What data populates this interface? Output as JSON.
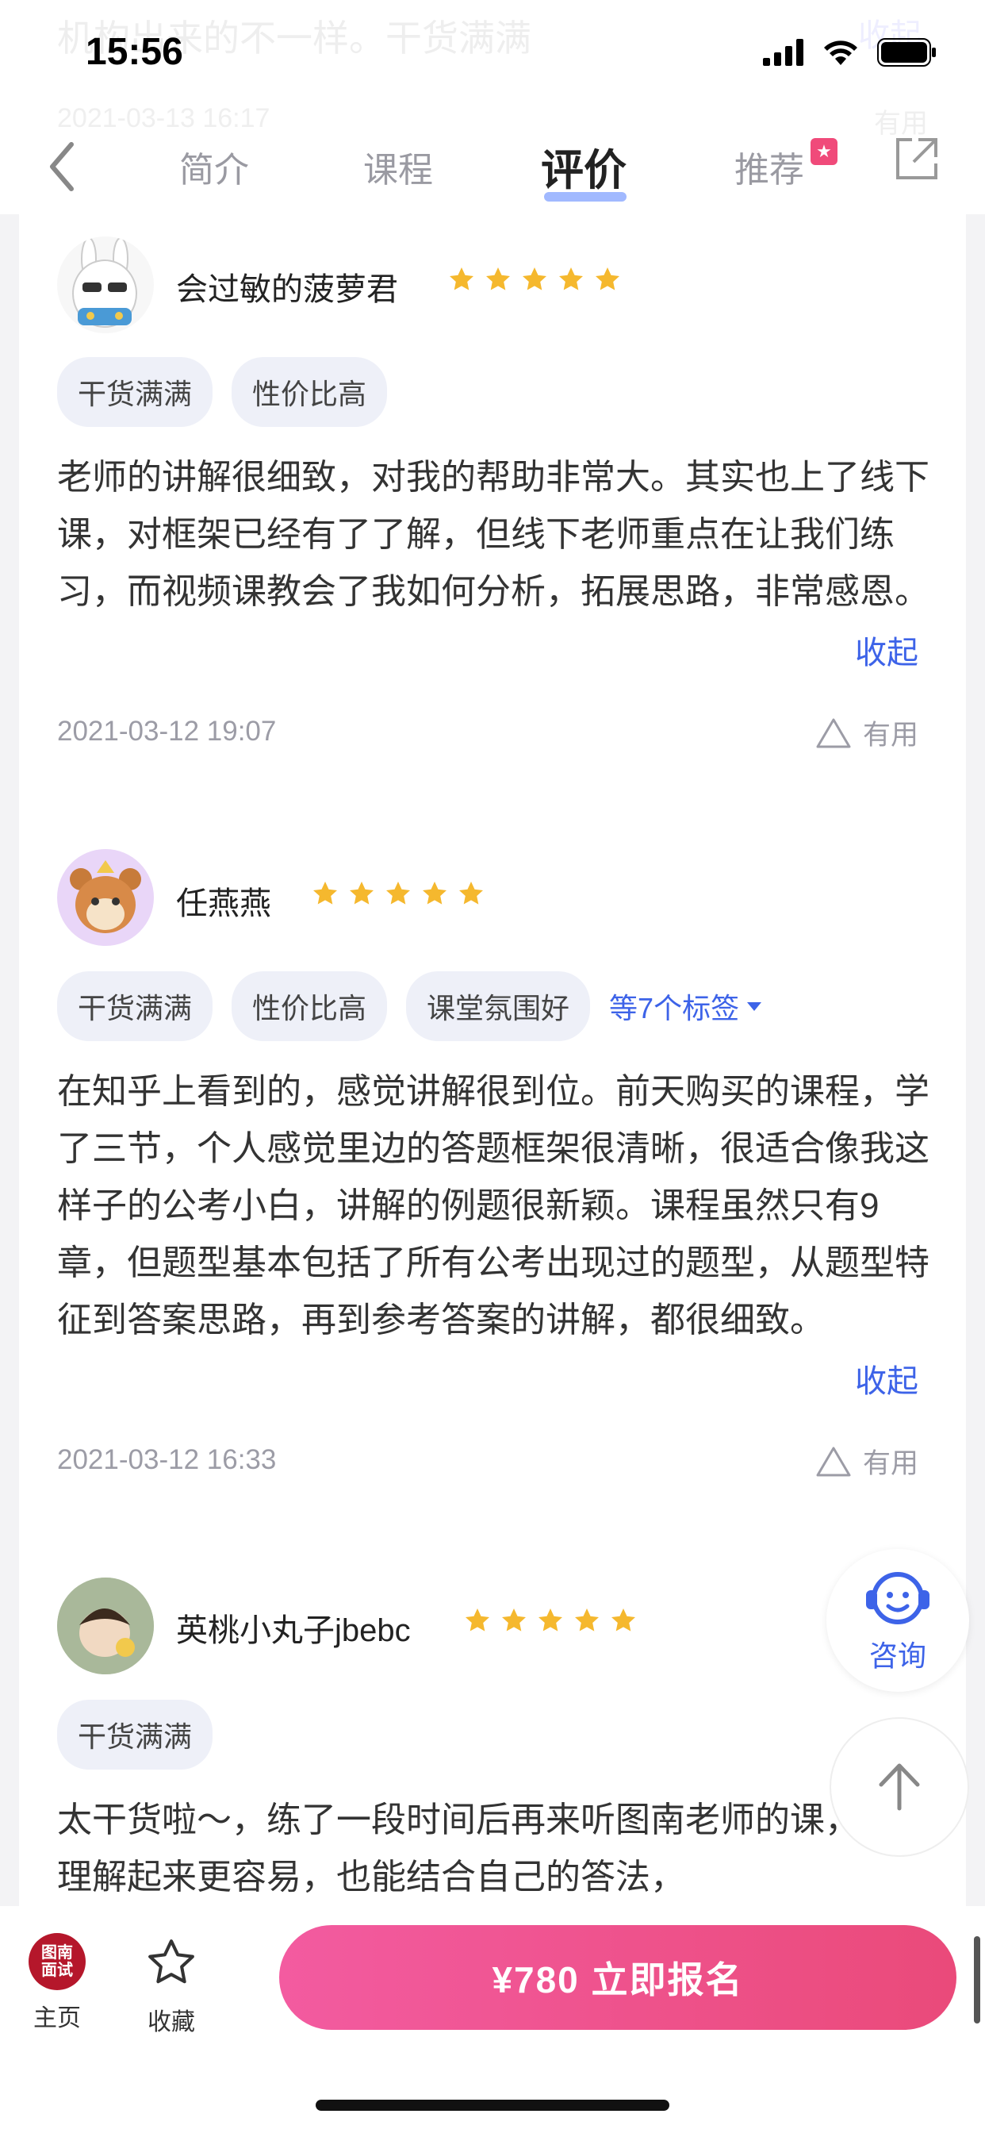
{
  "status": {
    "time": "15:56"
  },
  "ghost": {
    "prev_text": "机构出来的不一样。干货满满",
    "prev_collapse": "收起",
    "prev_date": "2021-03-13 16:17",
    "prev_useful": "有用"
  },
  "nav": {
    "tabs": [
      "简介",
      "课程",
      "评价",
      "推荐"
    ],
    "active": "评价"
  },
  "reviews": [
    {
      "name": "会过敏的菠萝君",
      "rating": 5,
      "tags": [
        "干货满满",
        "性价比高"
      ],
      "more_tags": "",
      "text": "老师的讲解很细致，对我的帮助非常大。其实也上了线下课，对框架已经有了了解，但线下老师重点在让我们练习，而视频课教会了我如何分析，拓展思路，非常感恩。",
      "collapse": "收起",
      "date": "2021-03-12 19:07",
      "useful": "有用"
    },
    {
      "name": "任燕燕",
      "rating": 5,
      "tags": [
        "干货满满",
        "性价比高",
        "课堂氛围好"
      ],
      "more_tags": "等7个标签",
      "text": "在知乎上看到的，感觉讲解很到位。前天购买的课程，学了三节，个人感觉里边的答题框架很清晰，很适合像我这样子的公考小白，讲解的例题很新颖。课程虽然只有9章，但题型基本包括了所有公考出现过的题型，从题型特征到答案思路，再到参考答案的讲解，都很细致。",
      "collapse": "收起",
      "date": "2021-03-12 16:33",
      "useful": "有用"
    },
    {
      "name": "英桃小丸子jbebc",
      "rating": 5,
      "tags": [
        "干货满满"
      ],
      "more_tags": "",
      "text": "太干货啦～，练了一段时间后再来听图南老师的课，感觉理解起来更容易，也能结合自己的答法，",
      "collapse": "",
      "date": "",
      "useful": ""
    }
  ],
  "floating": {
    "consult": "咨询"
  },
  "bottom": {
    "home_logo_line1": "图南",
    "home_logo_line2": "面试",
    "home_label": "主页",
    "fav_label": "收藏",
    "enroll_label": "¥780  立即报名"
  },
  "colors": {
    "accent": "#3d63e8",
    "enroll": "#ef4f8b",
    "star": "#f5b82e"
  }
}
